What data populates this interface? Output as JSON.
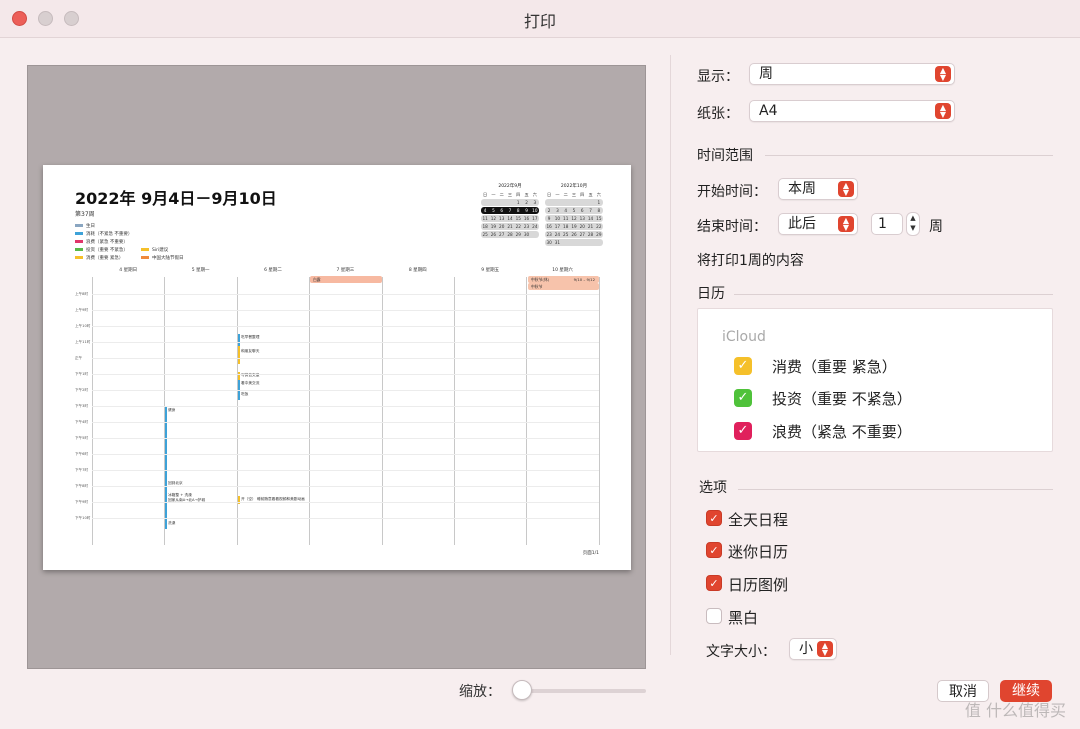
{
  "window": {
    "title": "打印"
  },
  "preview": {
    "title": "2022年 9月4日－9月10日",
    "week": "第37周",
    "legend": [
      {
        "label": "生日",
        "color": "#8aa6c1"
      },
      {
        "label": "消耗（不紧急 不重要）",
        "color": "#3da2d8"
      },
      {
        "label": "浪费（紧急 不重要）",
        "color": "#e0356a"
      },
      {
        "label": "投资（重要 不紧急）",
        "color": "#58b848"
      },
      {
        "label": "消费（重要 紧急）",
        "color": "#f5c02a"
      },
      {
        "label": "Siri建议",
        "color": "#f5c02a"
      },
      {
        "label": "中国大陆节假日",
        "color": "#f08a3c"
      }
    ],
    "mini_sep": {
      "title": "2022年9月",
      "header": [
        "日",
        "一",
        "二",
        "三",
        "四",
        "五",
        "六"
      ],
      "rows": [
        [
          "",
          "",
          "",
          "",
          "1",
          "2",
          "3"
        ],
        [
          "4",
          "5",
          "6",
          "7",
          "8",
          "9",
          "10"
        ],
        [
          "11",
          "12",
          "13",
          "14",
          "15",
          "16",
          "17"
        ],
        [
          "18",
          "19",
          "20",
          "21",
          "22",
          "23",
          "24"
        ],
        [
          "25",
          "26",
          "27",
          "28",
          "29",
          "30",
          ""
        ]
      ]
    },
    "mini_oct": {
      "title": "2022年10月",
      "header": [
        "日",
        "一",
        "二",
        "三",
        "四",
        "五",
        "六"
      ],
      "rows": [
        [
          "",
          "",
          "",
          "",
          "",
          "",
          "1"
        ],
        [
          "2",
          "3",
          "4",
          "5",
          "6",
          "7",
          "8"
        ],
        [
          "9",
          "10",
          "11",
          "12",
          "13",
          "14",
          "15"
        ],
        [
          "16",
          "17",
          "18",
          "19",
          "20",
          "21",
          "22"
        ],
        [
          "23",
          "24",
          "25",
          "26",
          "27",
          "28",
          "29"
        ],
        [
          "30",
          "31",
          "",
          "",
          "",
          "",
          ""
        ]
      ]
    },
    "days": [
      "4 星期日",
      "5 星期一",
      "6 星期二",
      "7 星期三",
      "8 星期四",
      "9 星期五",
      "10 星期六"
    ],
    "times": [
      "上午8时",
      "上午9时",
      "上午10时",
      "上午11时",
      "正午",
      "下午1时",
      "下午2时",
      "下午3时",
      "下午4时",
      "下午5时",
      "下午6时",
      "下午7时",
      "下午8时",
      "下午9时",
      "下午10时"
    ],
    "allday": {
      "wed": "白露",
      "sat1": "中秋节(休)",
      "sat1_range": "9/10 – 9/12",
      "sat2": "中秋节"
    },
    "events": {
      "e1": "吃早餐整理",
      "e2": "和朋友聊天",
      "e3": "写微信文章",
      "e4": "看中美交流",
      "e5": "吃饭",
      "e6": "健身",
      "e7": "回到北京",
      "e8": "冰箱整 + 洗澡",
      "e9": "回家从南A→北A→护城",
      "e10": "开（空）",
      "e10b": "睡前随意看看视频和美剧动画",
      "e11": "洗澡"
    },
    "footer": "页面1/1"
  },
  "zoom": {
    "label": "缩放：",
    "value": 0
  },
  "settings": {
    "display_label": "显示：",
    "display_value": "周",
    "paper_label": "纸张：",
    "paper_value": "A4",
    "time_range": "时间范围",
    "start_label": "开始时间：",
    "start_value": "本周",
    "end_label": "结束时间：",
    "end_value": "此后",
    "end_count": "1",
    "end_unit": "周",
    "summary": "将打印1周的内容",
    "calendar_section": "日历",
    "account": "iCloud",
    "calendars": [
      {
        "label": "消费（重要 紧急）",
        "color": "#f5c02a",
        "checked": true
      },
      {
        "label": "投资（重要 不紧急）",
        "color": "#4fc23a",
        "checked": true
      },
      {
        "label": "浪费（紧急 不重要）",
        "color": "#e0205c",
        "checked": true
      }
    ],
    "options_section": "选项",
    "options": [
      {
        "label": "全天日程",
        "checked": true
      },
      {
        "label": "迷你日历",
        "checked": true
      },
      {
        "label": "日历图例",
        "checked": true
      },
      {
        "label": "黑白",
        "checked": false
      }
    ],
    "font_size_label": "文字大小：",
    "font_size_value": "小"
  },
  "buttons": {
    "cancel": "取消",
    "continue": "继续"
  },
  "watermark": "值 什么值得买"
}
